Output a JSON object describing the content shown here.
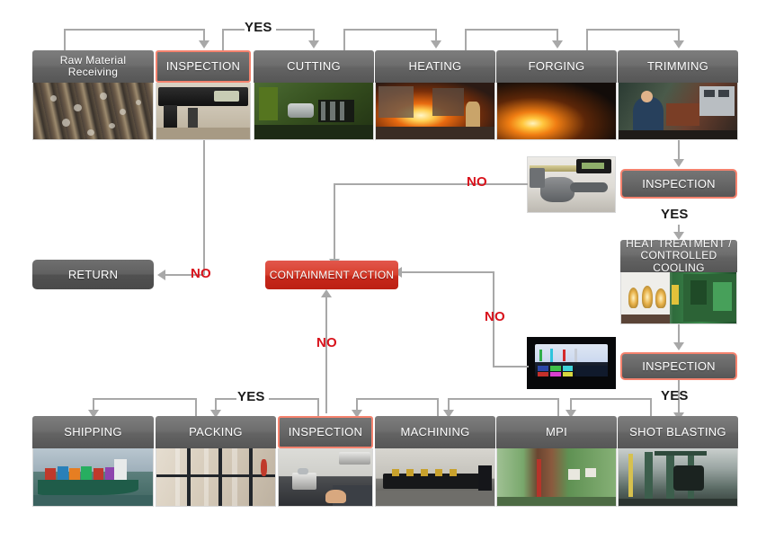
{
  "diagram": {
    "title": "Manufacturing Process Flowchart",
    "colors": {
      "node_gray_top": "#7d7d7d",
      "node_gray_bottom": "#565656",
      "highlight_border": "#f4826e",
      "containment_red": "#d8412f",
      "connector_gray": "#a8a8a8",
      "label_no_red": "#d8121b",
      "label_yes_black": "#1a1a1a"
    }
  },
  "nodes": {
    "raw_material": {
      "label": "Raw Material Receiving",
      "photo": "steel-bars-photo"
    },
    "inspection_1": {
      "label": "INSPECTION",
      "photo": "digital-caliper-photo",
      "highlighted": true
    },
    "cutting": {
      "label": "CUTTING",
      "photo": "cutting-machine-photo"
    },
    "heating": {
      "label": "HEATING",
      "photo": "heating-furnace-photo"
    },
    "forging": {
      "label": "FORGING",
      "photo": "forging-press-photo"
    },
    "trimming": {
      "label": "TRIMMING",
      "photo": "trimming-operator-photo"
    },
    "inspection_2": {
      "label": "INSPECTION",
      "highlighted": true
    },
    "heat_treatment": {
      "label_line1": "HEAT TREATMENT /",
      "label_line2": "CONTROLLED COOLING",
      "photo": "furnace-cooling-photo"
    },
    "inspection_3": {
      "label": "INSPECTION",
      "highlighted": true
    },
    "return_box": {
      "label": "RETURN"
    },
    "containment": {
      "label": "CONTAINMENT ACTION"
    },
    "shipping": {
      "label": "SHIPPING",
      "photo": "container-ship-photo"
    },
    "packing": {
      "label": "PACKING",
      "photo": "wooden-crate-photo"
    },
    "inspection_4": {
      "label": "INSPECTION",
      "photo": "measuring-bench-photo",
      "highlighted": true
    },
    "machining": {
      "label": "MACHINING",
      "photo": "cnc-machine-photo"
    },
    "mpi": {
      "label": "MPI",
      "photo": "mpi-station-photo"
    },
    "shot_blasting": {
      "label": "SHOT BLASTING",
      "photo": "shot-blasting-photo"
    }
  },
  "thumbnails": {
    "inspection_2_thumb": {
      "photo": "caliper-part-photo"
    },
    "inspection_3_thumb": {
      "photo": "test-monitor-photo"
    }
  },
  "edge_labels": {
    "yes_top": "YES",
    "yes_trimming": "YES",
    "yes_bottom_left": "YES",
    "yes_bottom_right": "YES",
    "no_return": "NO",
    "no_inspection_2": "NO",
    "no_inspection_3": "NO",
    "no_inspection_4": "NO"
  }
}
